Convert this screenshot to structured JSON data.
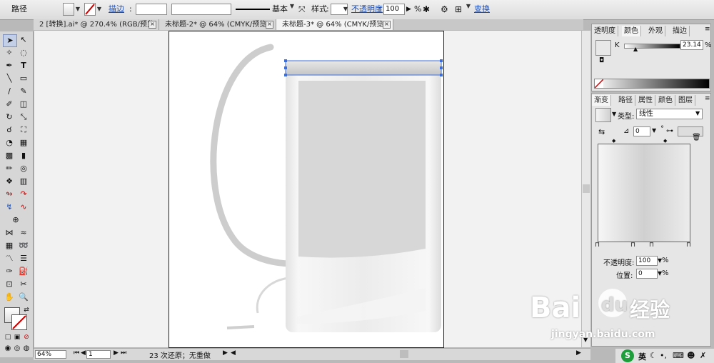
{
  "controlbar": {
    "object_type": "路径",
    "stroke_label": "描边",
    "stroke_style": "基本",
    "style_label": "样式",
    "opacity_label": "不透明度",
    "opacity_value": "100",
    "opacity_unit": "%",
    "transform_label": "变换"
  },
  "tabs": [
    {
      "label": "2 [转换].ai* @ 270.4% (RGB/预览)"
    },
    {
      "label": "未标题-2* @ 64% (CMYK/预览)"
    },
    {
      "label": "未标题-3* @ 64% (CMYK/预览)"
    }
  ],
  "statusbar": {
    "zoom": "64%",
    "page": "1",
    "history": "23 次还原；无重做"
  },
  "panel_top": {
    "tabs": [
      "透明度",
      "颜色",
      "外观",
      "描边"
    ],
    "channel_label": "K",
    "channel_value": "23.14",
    "channel_unit": "%"
  },
  "panel_gradient": {
    "tabs": [
      "渐变",
      "路径",
      "属性",
      "颜色",
      "图层"
    ],
    "type_label": "类型:",
    "type_value": "线性",
    "angle_value": "0",
    "degree": "°",
    "opacity_label": "不透明度:",
    "opacity_value": "100",
    "location_label": "位置:",
    "location_value": "0",
    "unit": "%"
  },
  "watermark": {
    "brand": "Bai",
    "brand2": "du",
    "cn": "经验",
    "url": "jingyan.baidu.com"
  },
  "tray": {
    "ime": "英"
  },
  "colors": {
    "accent": "#1a4fbf",
    "selection": "#3c6ddc",
    "cup_gray": "#c9c9c9"
  }
}
